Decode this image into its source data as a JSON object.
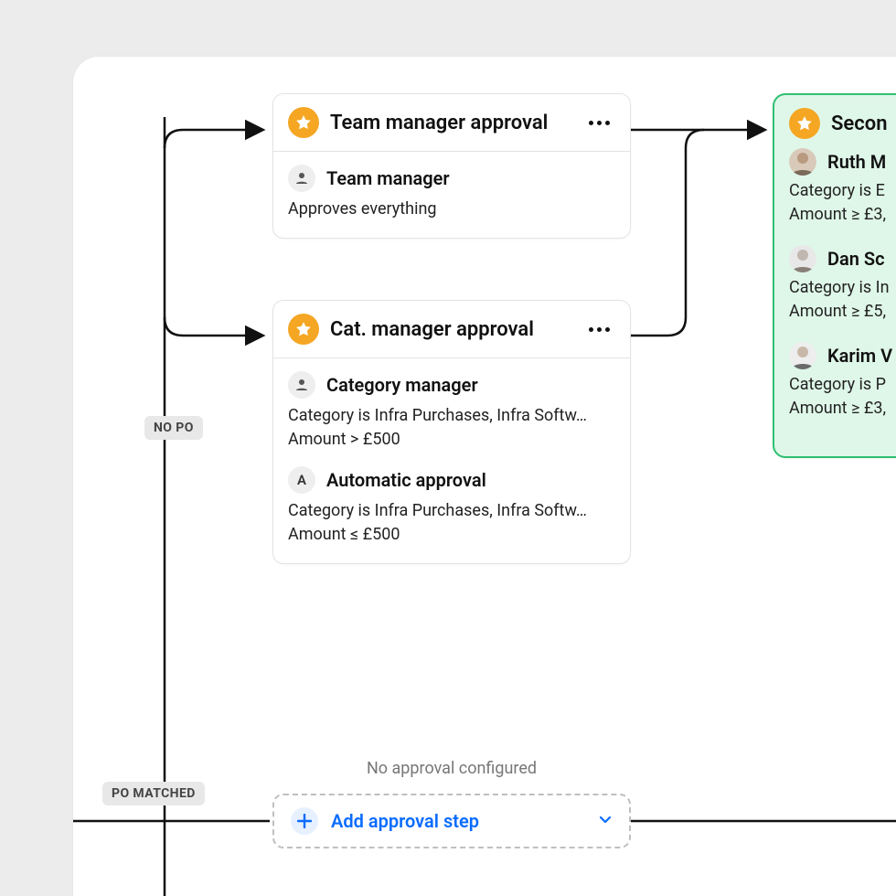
{
  "tags": {
    "no_po": "NO PO",
    "po_matched": "PO MATCHED"
  },
  "card_team": {
    "title": "Team manager approval",
    "rule1_name": "Team manager",
    "rule1_desc": "Approves everything"
  },
  "card_cat": {
    "title": "Cat. manager approval",
    "rule1_name": "Category manager",
    "rule1_desc1": "Category is Infra Purchases, Infra Softw…",
    "rule1_desc2": "Amount > £500",
    "rule2_letter": "A",
    "rule2_name": "Automatic approval",
    "rule2_desc1": "Category is Infra Purchases, Infra Softw…",
    "rule2_desc2": "Amount ≤ £500"
  },
  "card_second": {
    "title": "Secon",
    "p1_name": "Ruth M",
    "p1_desc1": "Category is E",
    "p1_desc2": "Amount ≥ £3,",
    "p2_name": "Dan Sc",
    "p2_desc1": "Category is In",
    "p2_desc2": "Amount ≥ £5,",
    "p3_name": "Karim V",
    "p3_desc1": "Category is P",
    "p3_desc2": "Amount ≥ £3,"
  },
  "empty_branch": {
    "label": "No approval configured",
    "button": "Add approval step"
  }
}
